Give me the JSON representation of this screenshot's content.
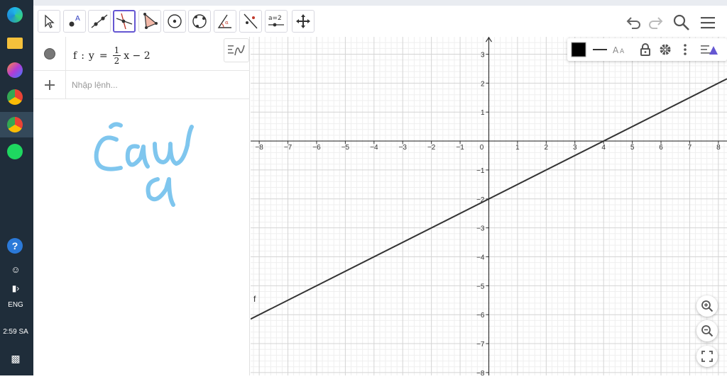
{
  "taskbar": {
    "lang": "ENG",
    "time": "2:59 SA"
  },
  "toolbar": {
    "tools": [
      {
        "name": "move-tool",
        "icon": "arrow-cursor-icon"
      },
      {
        "name": "point-tool",
        "icon": "point-icon"
      },
      {
        "name": "line-tool",
        "icon": "line-icon"
      },
      {
        "name": "perpendicular-line-tool",
        "icon": "perpendicular-icon"
      },
      {
        "name": "polygon-tool",
        "icon": "polygon-icon"
      },
      {
        "name": "circle-tool",
        "icon": "circle-center-icon"
      },
      {
        "name": "circle-three-points-tool",
        "icon": "circle-three-points-icon"
      },
      {
        "name": "angle-tool",
        "icon": "angle-icon"
      },
      {
        "name": "reflect-tool",
        "icon": "reflect-icon"
      },
      {
        "name": "slider-tool",
        "icon": "slider-icon",
        "label": "a=2"
      },
      {
        "name": "move-graphics-tool",
        "icon": "move-graphics-icon"
      }
    ],
    "active_tool": "perpendicular-line-tool"
  },
  "algebra": {
    "function_name": "f",
    "equation_lhs": "y",
    "numerator": "1",
    "denominator": "2",
    "equation_rest": "x − 2",
    "input_placeholder": "Nhập lệnh...",
    "handwriting": "câu a",
    "handwriting_color": "#7fc6ee"
  },
  "graphics": {
    "function_label": "f",
    "line_color": "#333333",
    "x_ticks": [
      "−8",
      "−7",
      "−6",
      "−5",
      "−4",
      "−3",
      "−2",
      "−1",
      "0",
      "1",
      "2",
      "3",
      "4",
      "5",
      "6",
      "7",
      "8"
    ],
    "y_ticks_pos": [
      "3",
      "2",
      "1"
    ],
    "y_ticks_neg": [
      "−1",
      "−2",
      "−3",
      "−4",
      "−5",
      "−6",
      "−7",
      "−8"
    ],
    "style_bar_color": "#000000"
  },
  "chart_data": {
    "type": "line",
    "title": "",
    "xlabel": "",
    "ylabel": "",
    "xlim": [
      -8.3,
      8.3
    ],
    "ylim": [
      -8.1,
      3.6
    ],
    "grid": true,
    "series": [
      {
        "name": "f",
        "x": [
          -8.3,
          8.3
        ],
        "y": [
          -6.15,
          2.15
        ],
        "slope": 0.5,
        "intercept": -2
      }
    ]
  }
}
